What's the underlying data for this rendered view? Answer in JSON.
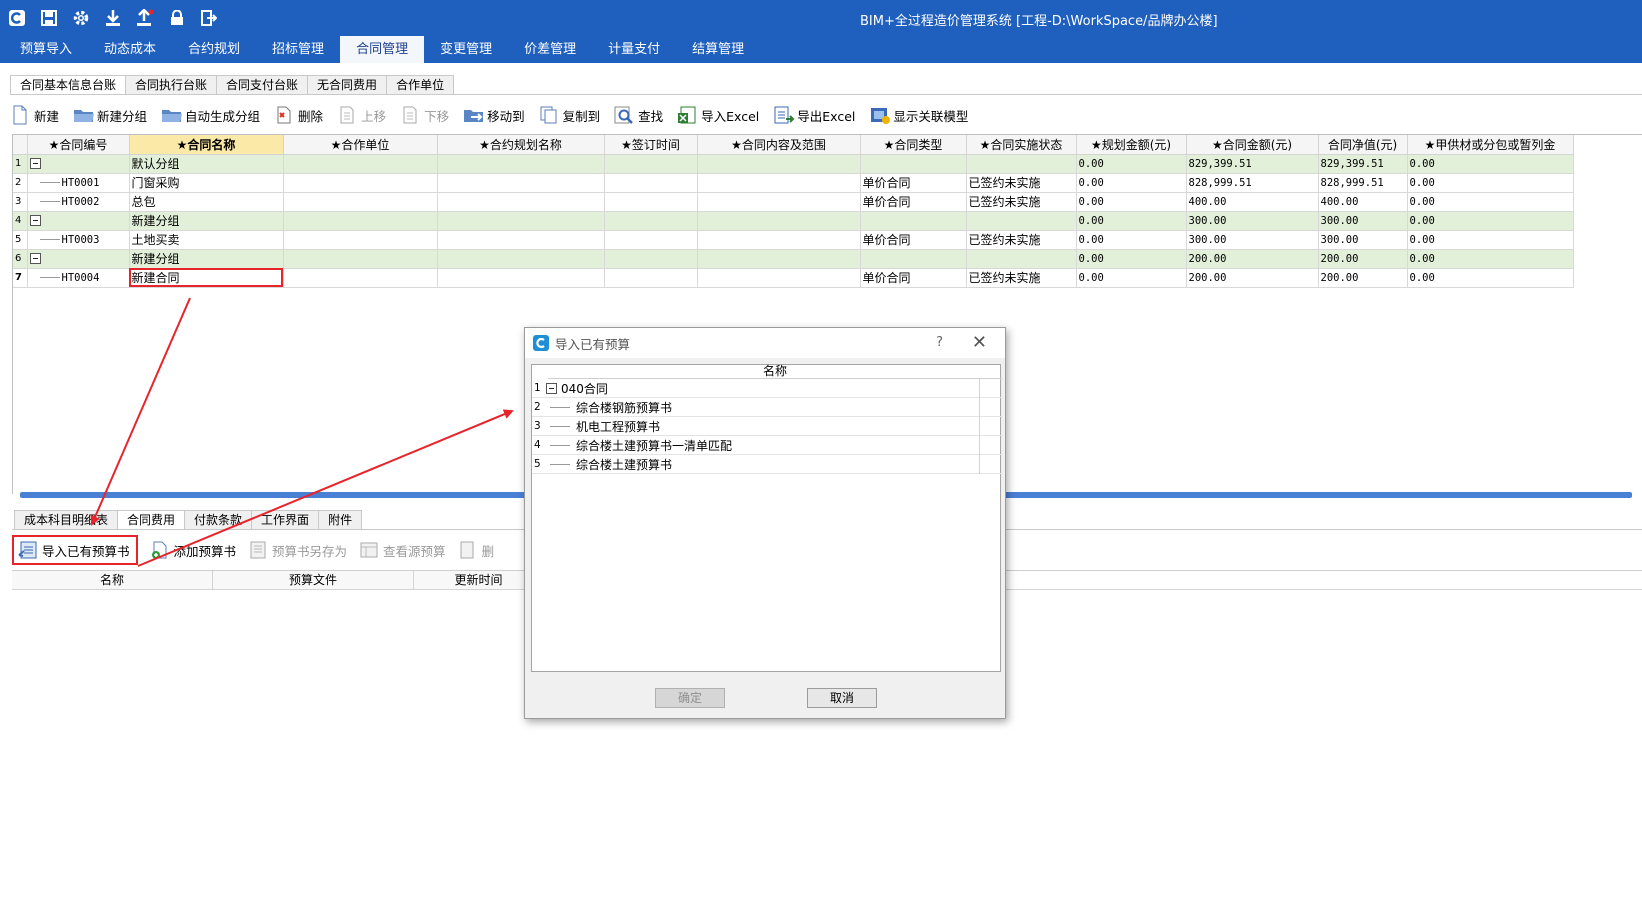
{
  "window": {
    "title": "BIM+全过程造价管理系统 [工程-D:\\WorkSpace/品牌办公楼]"
  },
  "quick_access": [
    "logo-icon",
    "save-icon",
    "settings-icon",
    "download-icon",
    "upload-icon",
    "lock-icon",
    "exit-icon"
  ],
  "menu": [
    "预算导入",
    "动态成本",
    "合约规划",
    "招标管理",
    "合同管理",
    "变更管理",
    "价差管理",
    "计量支付",
    "结算管理"
  ],
  "subtabs": [
    "合同基本信息台账",
    "合同执行台账",
    "合同支付台账",
    "无合同费用",
    "合作单位"
  ],
  "toolbar": {
    "new": "新建",
    "new_group": "新建分组",
    "auto_group": "自动生成分组",
    "delete": "删除",
    "move_up": "上移",
    "move_down": "下移",
    "move_to": "移动到",
    "copy_to": "复制到",
    "find": "查找",
    "import_excel": "导入Excel",
    "export_excel": "导出Excel",
    "show_model": "显示关联模型"
  },
  "grid": {
    "headers": [
      "★合同编号",
      "★合同名称",
      "★合作单位",
      "★合约规划名称",
      "★签订时间",
      "★合同内容及范围",
      "★合同类型",
      "★合同实施状态",
      "★规划金额(元)",
      "★合同金额(元)",
      "合同净值(元)",
      "★甲供材或分包或暂列金"
    ],
    "rows": [
      {
        "n": "1",
        "group": true,
        "code": "",
        "name": "默认分组",
        "type": "",
        "status": "",
        "plan": "0.00",
        "amount": "829,399.51",
        "net": "829,399.51",
        "extra": "0.00"
      },
      {
        "n": "2",
        "group": false,
        "code": "HT0001",
        "name": "门窗采购",
        "type": "单价合同",
        "status": "已签约未实施",
        "plan": "0.00",
        "amount": "828,999.51",
        "net": "828,999.51",
        "extra": "0.00"
      },
      {
        "n": "3",
        "group": false,
        "code": "HT0002",
        "name": "总包",
        "type": "单价合同",
        "status": "已签约未实施",
        "plan": "0.00",
        "amount": "400.00",
        "net": "400.00",
        "extra": "0.00"
      },
      {
        "n": "4",
        "group": true,
        "code": "",
        "name": "新建分组",
        "type": "",
        "status": "",
        "plan": "0.00",
        "amount": "300.00",
        "net": "300.00",
        "extra": "0.00"
      },
      {
        "n": "5",
        "group": false,
        "code": "HT0003",
        "name": "土地买卖",
        "type": "单价合同",
        "status": "已签约未实施",
        "plan": "0.00",
        "amount": "300.00",
        "net": "300.00",
        "extra": "0.00"
      },
      {
        "n": "6",
        "group": true,
        "code": "",
        "name": "新建分组",
        "type": "",
        "status": "",
        "plan": "0.00",
        "amount": "200.00",
        "net": "200.00",
        "extra": "0.00"
      },
      {
        "n": "7",
        "group": false,
        "code": "HT0004",
        "name": "新建合同",
        "type": "单价合同",
        "status": "已签约未实施",
        "plan": "0.00",
        "amount": "200.00",
        "net": "200.00",
        "extra": "0.00"
      }
    ]
  },
  "bottom": {
    "tabs": [
      "成本科目明细表",
      "合同费用",
      "付款条款",
      "工作界面",
      "附件"
    ],
    "toolbar": {
      "import_budget": "导入已有预算书",
      "add_budget": "添加预算书",
      "save_as": "预算书另存为",
      "view_source": "查看源预算",
      "more": "删"
    },
    "headers": [
      "名称",
      "预算文件",
      "更新时间"
    ]
  },
  "dialog": {
    "title": "导入已有预算",
    "help": "?",
    "close": "✕",
    "list_header": "名称",
    "items": [
      {
        "n": "1",
        "name": "040合同",
        "root": true
      },
      {
        "n": "2",
        "name": "综合楼钢筋预算书",
        "root": false
      },
      {
        "n": "3",
        "name": "机电工程预算书",
        "root": false
      },
      {
        "n": "4",
        "name": "综合楼土建预算书一清单匹配",
        "root": false
      },
      {
        "n": "5",
        "name": "综合楼土建预算书",
        "root": false
      }
    ],
    "ok": "确定",
    "cancel": "取消"
  },
  "colors": {
    "accent": "#1f5fbd",
    "group_row": "#e2efd9",
    "highlight": "#e8242b"
  }
}
